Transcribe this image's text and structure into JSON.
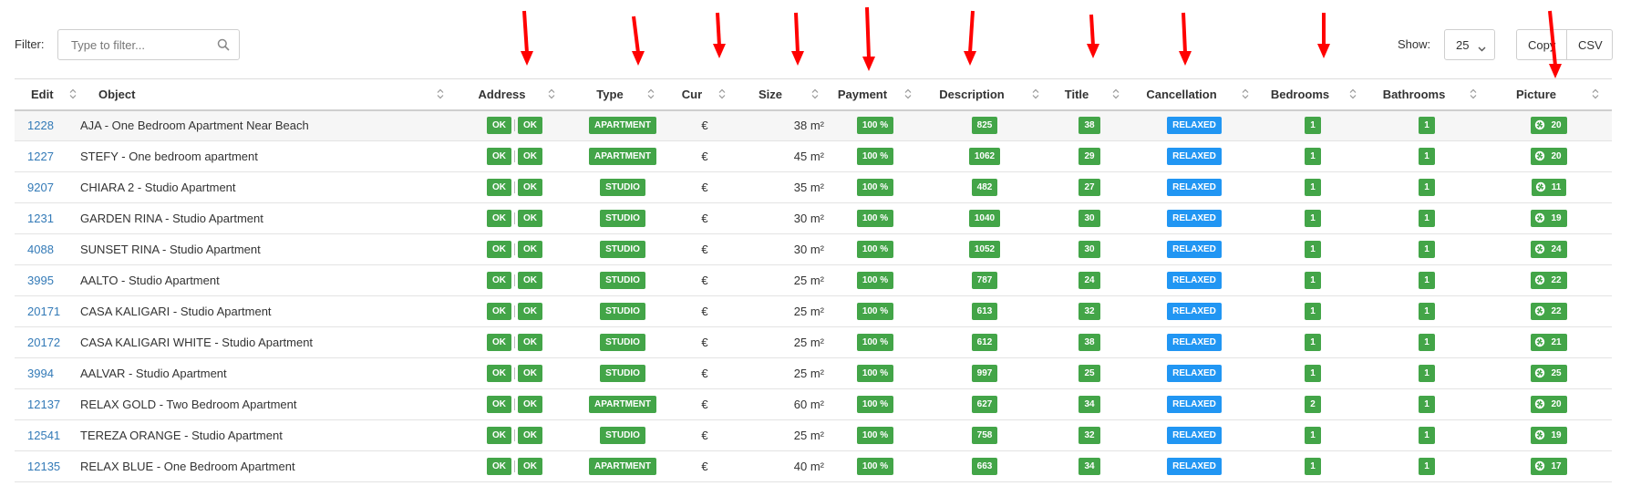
{
  "toolbar": {
    "filter_label": "Filter:",
    "filter_placeholder": "Type to filter...",
    "show_label": "Show:",
    "show_value": "25",
    "copy_label": "Copy",
    "csv_label": "CSV"
  },
  "columns": [
    "Edit",
    "Object",
    "Address",
    "Type",
    "Cur",
    "Size",
    "Payment",
    "Description",
    "Title",
    "Cancellation",
    "Bedrooms",
    "Bathrooms",
    "Picture"
  ],
  "colors": {
    "green": "#43a548",
    "blue": "#2196f3",
    "link": "#337ab7",
    "arrow": "#ff0000"
  },
  "rows": [
    {
      "id": "1228",
      "object": "AJA - One Bedroom Apartment Near Beach",
      "addr1": "OK",
      "addr2": "OK",
      "type": "APARTMENT",
      "cur": "€",
      "size": "38 m²",
      "payment": "100 %",
      "description": "825",
      "title": "38",
      "cancellation": "RELAXED",
      "bedrooms": "1",
      "bathrooms": "1",
      "picture": "20"
    },
    {
      "id": "1227",
      "object": "STEFY - One bedroom apartment",
      "addr1": "OK",
      "addr2": "OK",
      "type": "APARTMENT",
      "cur": "€",
      "size": "45 m²",
      "payment": "100 %",
      "description": "1062",
      "title": "29",
      "cancellation": "RELAXED",
      "bedrooms": "1",
      "bathrooms": "1",
      "picture": "20"
    },
    {
      "id": "9207",
      "object": "CHIARA 2 - Studio Apartment",
      "addr1": "OK",
      "addr2": "OK",
      "type": "STUDIO",
      "cur": "€",
      "size": "35 m²",
      "payment": "100 %",
      "description": "482",
      "title": "27",
      "cancellation": "RELAXED",
      "bedrooms": "1",
      "bathrooms": "1",
      "picture": "11"
    },
    {
      "id": "1231",
      "object": "GARDEN RINA - Studio Apartment",
      "addr1": "OK",
      "addr2": "OK",
      "type": "STUDIO",
      "cur": "€",
      "size": "30 m²",
      "payment": "100 %",
      "description": "1040",
      "title": "30",
      "cancellation": "RELAXED",
      "bedrooms": "1",
      "bathrooms": "1",
      "picture": "19"
    },
    {
      "id": "4088",
      "object": "SUNSET RINA - Studio Apartment",
      "addr1": "OK",
      "addr2": "OK",
      "type": "STUDIO",
      "cur": "€",
      "size": "30 m²",
      "payment": "100 %",
      "description": "1052",
      "title": "30",
      "cancellation": "RELAXED",
      "bedrooms": "1",
      "bathrooms": "1",
      "picture": "24"
    },
    {
      "id": "3995",
      "object": "AALTO - Studio Apartment",
      "addr1": "OK",
      "addr2": "OK",
      "type": "STUDIO",
      "cur": "€",
      "size": "25 m²",
      "payment": "100 %",
      "description": "787",
      "title": "24",
      "cancellation": "RELAXED",
      "bedrooms": "1",
      "bathrooms": "1",
      "picture": "22"
    },
    {
      "id": "20171",
      "object": "CASA KALIGARI - Studio Apartment",
      "addr1": "OK",
      "addr2": "OK",
      "type": "STUDIO",
      "cur": "€",
      "size": "25 m²",
      "payment": "100 %",
      "description": "613",
      "title": "32",
      "cancellation": "RELAXED",
      "bedrooms": "1",
      "bathrooms": "1",
      "picture": "22"
    },
    {
      "id": "20172",
      "object": "CASA KALIGARI WHITE - Studio Apartment",
      "addr1": "OK",
      "addr2": "OK",
      "type": "STUDIO",
      "cur": "€",
      "size": "25 m²",
      "payment": "100 %",
      "description": "612",
      "title": "38",
      "cancellation": "RELAXED",
      "bedrooms": "1",
      "bathrooms": "1",
      "picture": "21"
    },
    {
      "id": "3994",
      "object": "AALVAR - Studio Apartment",
      "addr1": "OK",
      "addr2": "OK",
      "type": "STUDIO",
      "cur": "€",
      "size": "25 m²",
      "payment": "100 %",
      "description": "997",
      "title": "25",
      "cancellation": "RELAXED",
      "bedrooms": "1",
      "bathrooms": "1",
      "picture": "25"
    },
    {
      "id": "12137",
      "object": "RELAX GOLD - Two Bedroom Apartment",
      "addr1": "OK",
      "addr2": "OK",
      "type": "APARTMENT",
      "cur": "€",
      "size": "60 m²",
      "payment": "100 %",
      "description": "627",
      "title": "34",
      "cancellation": "RELAXED",
      "bedrooms": "2",
      "bathrooms": "1",
      "picture": "20"
    },
    {
      "id": "12541",
      "object": "TEREZA ORANGE - Studio Apartment",
      "addr1": "OK",
      "addr2": "OK",
      "type": "STUDIO",
      "cur": "€",
      "size": "25 m²",
      "payment": "100 %",
      "description": "758",
      "title": "32",
      "cancellation": "RELAXED",
      "bedrooms": "1",
      "bathrooms": "1",
      "picture": "19"
    },
    {
      "id": "12135",
      "object": "RELAX BLUE - One Bedroom Apartment",
      "addr1": "OK",
      "addr2": "OK",
      "type": "APARTMENT",
      "cur": "€",
      "size": "40 m²",
      "payment": "100 %",
      "description": "663",
      "title": "34",
      "cancellation": "RELAXED",
      "bedrooms": "1",
      "bathrooms": "1",
      "picture": "17"
    }
  ]
}
